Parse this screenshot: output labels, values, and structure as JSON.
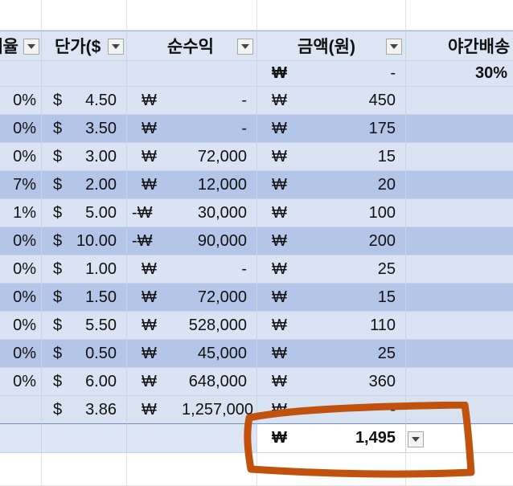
{
  "columns": {
    "ratio": "배율",
    "unit_price": "단가($",
    "net_profit": "순수익",
    "amount": "금액(원)",
    "night_delivery": "야간배송"
  },
  "summary_row": {
    "amount_symbol": "₩",
    "amount": "-",
    "night_delivery": "30%"
  },
  "rows": [
    {
      "ratio": "0%",
      "usd": "$",
      "price": "4.50",
      "won": "₩",
      "profit": "-",
      "amt_sym": "₩",
      "amount": "450"
    },
    {
      "ratio": "0%",
      "usd": "$",
      "price": "3.50",
      "won": "₩",
      "profit": "-",
      "amt_sym": "₩",
      "amount": "175"
    },
    {
      "ratio": "0%",
      "usd": "$",
      "price": "3.00",
      "won": "₩",
      "profit": "72,000",
      "amt_sym": "₩",
      "amount": "15"
    },
    {
      "ratio": "7%",
      "usd": "$",
      "price": "2.00",
      "won": "₩",
      "profit": "12,000",
      "amt_sym": "₩",
      "amount": "20"
    },
    {
      "ratio": "1%",
      "usd": "$",
      "price": "5.00",
      "won": "-₩",
      "profit": "30,000",
      "amt_sym": "₩",
      "amount": "100"
    },
    {
      "ratio": "0%",
      "usd": "$",
      "price": "10.00",
      "won": "-₩",
      "profit": "90,000",
      "amt_sym": "₩",
      "amount": "200"
    },
    {
      "ratio": "0%",
      "usd": "$",
      "price": "1.00",
      "won": "₩",
      "profit": "-",
      "amt_sym": "₩",
      "amount": "25"
    },
    {
      "ratio": "0%",
      "usd": "$",
      "price": "1.50",
      "won": "₩",
      "profit": "72,000",
      "amt_sym": "₩",
      "amount": "15"
    },
    {
      "ratio": "0%",
      "usd": "$",
      "price": "5.50",
      "won": "₩",
      "profit": "528,000",
      "amt_sym": "₩",
      "amount": "110"
    },
    {
      "ratio": "0%",
      "usd": "$",
      "price": "0.50",
      "won": "₩",
      "profit": "45,000",
      "amt_sym": "₩",
      "amount": "25"
    },
    {
      "ratio": "0%",
      "usd": "$",
      "price": "6.00",
      "won": "₩",
      "profit": "648,000",
      "amt_sym": "₩",
      "amount": "360"
    }
  ],
  "total_row": {
    "usd": "$",
    "price": "3.86",
    "won": "₩",
    "profit": "1,257,000",
    "amt_sym": "₩",
    "amount": "-"
  },
  "grand_total": {
    "symbol": "₩",
    "amount": "1,495"
  },
  "icons": {
    "filter": "dropdown-arrow-icon"
  },
  "colors": {
    "header_bg": "#dbe5f4",
    "band_light": "#dae3f3",
    "band_dark": "#b4c6e7",
    "annotation": "#c0520e"
  }
}
